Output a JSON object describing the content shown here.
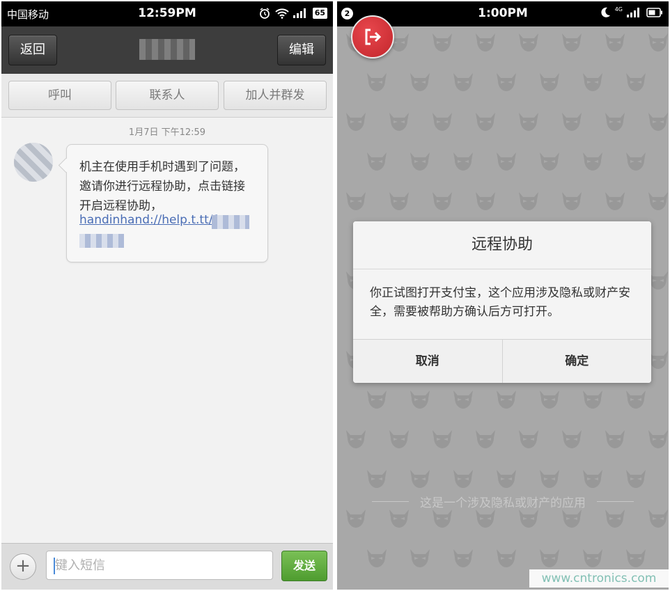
{
  "left": {
    "status": {
      "carrier": "中国移动",
      "time": "12:59PM",
      "battery": "65"
    },
    "header": {
      "back_label": "返回",
      "edit_label": "编辑"
    },
    "actions": [
      "呼叫",
      "联系人",
      "加人并群发"
    ],
    "message": {
      "timestamp": "1月7日 下午12:59",
      "text": "机主在使用手机时遇到了问题，邀请你进行远程协助，点击链接开启远程协助，",
      "link": "handinhand://help.t.tt/1"
    },
    "input": {
      "placeholder": "键入短信",
      "send_label": "发送"
    }
  },
  "right": {
    "status": {
      "time": "1:00PM",
      "notification_count": "2",
      "network": "4G"
    },
    "dialog": {
      "title": "远程协助",
      "body": "你正试图打开支付宝，这个应用涉及隐私或财产安全，需要被帮助方确认后方可打开。",
      "cancel_label": "取消",
      "confirm_label": "确定"
    },
    "footer_text": "这是一个涉及隐私或财产的应用"
  },
  "watermark": "www.cntronics.com",
  "colors": {
    "send_green": "#5aa83a",
    "exit_red": "#d0302f",
    "link_blue": "#4a6db5"
  },
  "icons": {
    "alarm": "alarm-icon",
    "wifi": "wifi-icon",
    "signal": "signal-icon",
    "moon": "moon-icon",
    "exit": "exit-icon",
    "plus": "plus-icon",
    "background_pattern": "devil-mask-icon"
  }
}
